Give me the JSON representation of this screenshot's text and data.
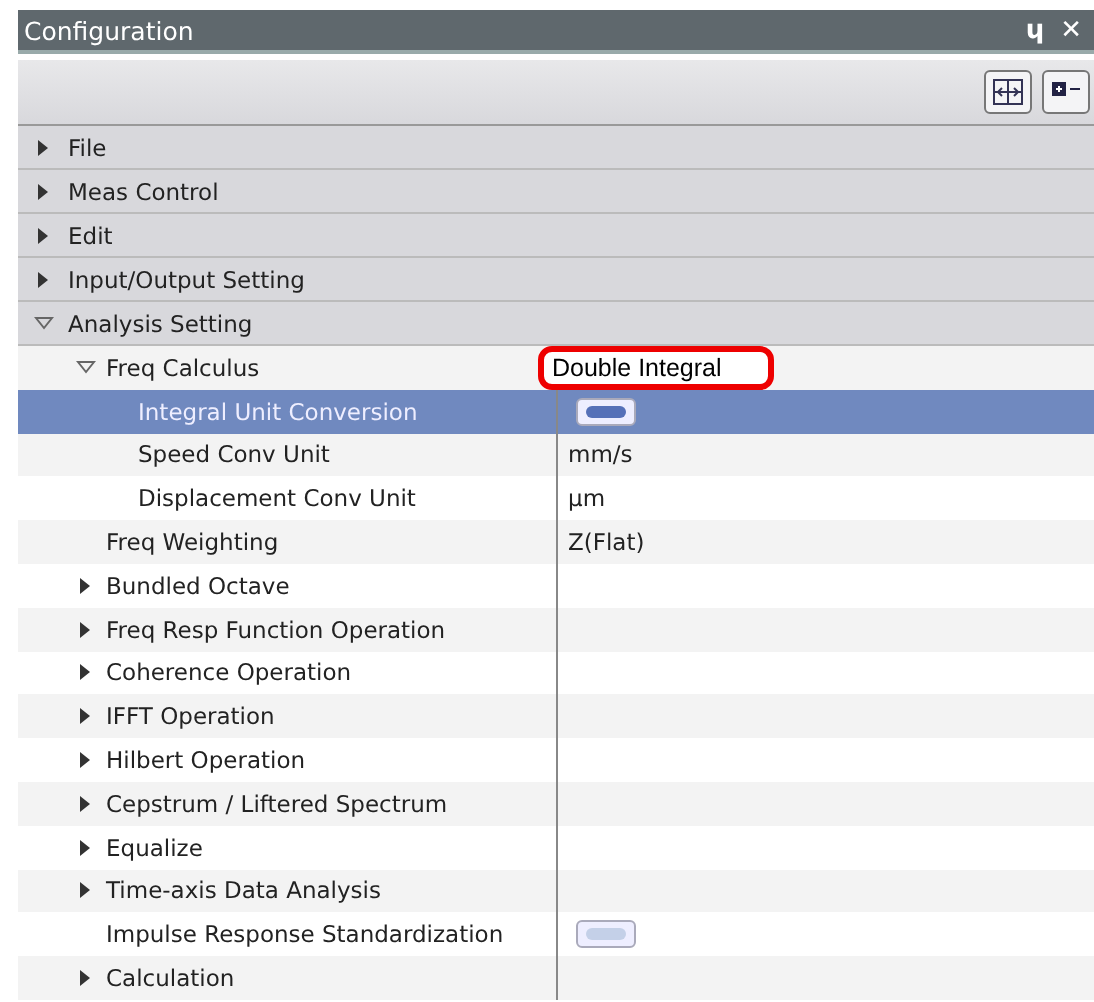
{
  "window": {
    "title": "Configuration",
    "pin_icon": "ɥ",
    "close_icon": "✕"
  },
  "categories": [
    {
      "label": "File",
      "expanded": false
    },
    {
      "label": "Meas Control",
      "expanded": false
    },
    {
      "label": "Edit",
      "expanded": false
    },
    {
      "label": "Input/Output Setting",
      "expanded": false
    },
    {
      "label": "Analysis Setting",
      "expanded": true,
      "children": [
        {
          "label": "Freq Calculus",
          "value": "Double Integral",
          "highlighted": true,
          "expanded": true,
          "selected": false,
          "children": [
            {
              "label": "Integral Unit Conversion",
              "kind": "toggle",
              "on": true,
              "selected": true
            },
            {
              "label": "Speed Conv Unit",
              "value": "mm/s",
              "selected": false
            },
            {
              "label": "Displacement Conv Unit",
              "value": "μm",
              "selected": false
            }
          ]
        },
        {
          "label": "Freq Weighting",
          "value": "Z(Flat)",
          "selected": false
        },
        {
          "label": "Bundled Octave",
          "expanded": false,
          "selected": false
        },
        {
          "label": "Freq Resp Function Operation",
          "expanded": false,
          "selected": false
        },
        {
          "label": "Coherence Operation",
          "expanded": false,
          "selected": false
        },
        {
          "label": "IFFT Operation",
          "expanded": false,
          "selected": false
        },
        {
          "label": "Hilbert Operation",
          "expanded": false,
          "selected": false
        },
        {
          "label": "Cepstrum / Liftered Spectrum",
          "expanded": false,
          "selected": false
        },
        {
          "label": "Equalize",
          "expanded": false,
          "selected": false
        },
        {
          "label": "Time-axis Data Analysis",
          "expanded": false,
          "selected": false
        },
        {
          "label": "Impulse Response Standardization",
          "kind": "toggle",
          "on": false,
          "selected": false
        },
        {
          "label": "Calculation",
          "expanded": false,
          "selected": false
        }
      ]
    }
  ]
}
